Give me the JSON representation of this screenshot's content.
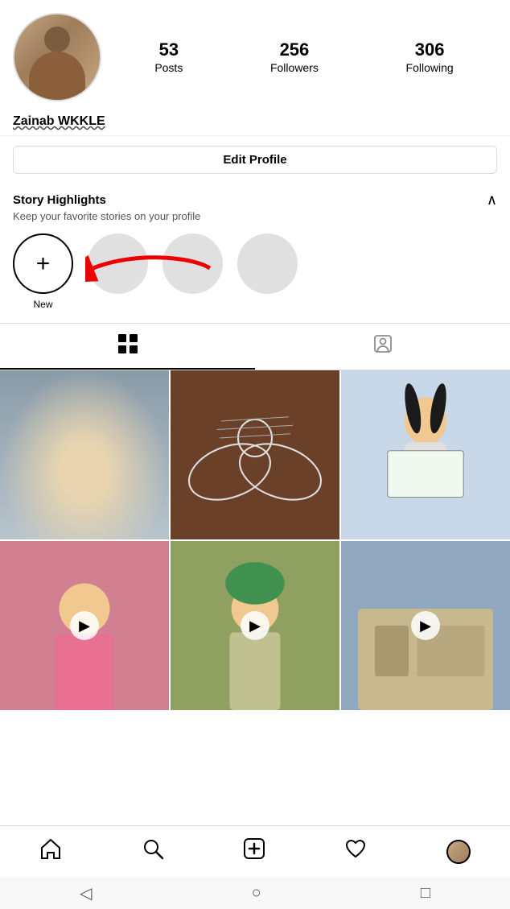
{
  "profile": {
    "username": "Zainab WKKLE",
    "posts_count": "53",
    "posts_label": "Posts",
    "followers_count": "256",
    "followers_label": "Followers",
    "following_count": "306",
    "following_label": "Following"
  },
  "buttons": {
    "edit_profile": "Edit Profile"
  },
  "story_highlights": {
    "title": "Story Highlights",
    "subtitle": "Keep your favorite stories on your profile",
    "new_label": "New"
  },
  "tabs": {
    "grid_icon": "⊞",
    "person_icon": "👤"
  },
  "bottom_nav": {
    "home_icon": "🏠",
    "search_icon": "🔍",
    "add_icon": "➕",
    "heart_icon": "♡",
    "profile_icon": "👤"
  },
  "system_nav": {
    "back": "◁",
    "home": "○",
    "recent": "□"
  }
}
